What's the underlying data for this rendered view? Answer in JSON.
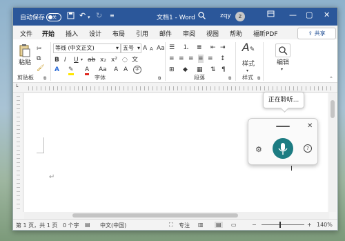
{
  "titlebar": {
    "autosave_label": "自动保存",
    "autosave_state": "关",
    "doc_title": "文档1 - Word",
    "user_name": "zqy",
    "avatar_initial": "z"
  },
  "tabs": [
    "文件",
    "开始",
    "插入",
    "设计",
    "布局",
    "引用",
    "邮件",
    "审阅",
    "视图",
    "帮助",
    "福昕PDF"
  ],
  "active_tab": "开始",
  "share_label": "共享",
  "ribbon": {
    "clipboard": {
      "paste_label": "粘贴",
      "group_label": "剪贴板"
    },
    "font": {
      "font_name": "等线 (中文正文)",
      "font_size": "五号",
      "size_up": "A",
      "size_down": "A",
      "clear_fmt": "Aa",
      "bold": "B",
      "italic": "I",
      "underline": "U",
      "strike": "ab",
      "subscript": "x₂",
      "superscript": "x²",
      "text_effect": "A",
      "highlight": "✎",
      "font_color": "A",
      "change_case": "Aa",
      "grow_a": "A",
      "phonetic": "A",
      "enclose": "字",
      "group_label": "字体"
    },
    "paragraph": {
      "group_label": "段落"
    },
    "styles": {
      "label": "样式",
      "group_label": "样式"
    },
    "editing": {
      "label": "编辑"
    }
  },
  "dictate": {
    "listening_text": "正在聆听...",
    "help_symbol": "?"
  },
  "document": {
    "paragraph_mark": "↵"
  },
  "statusbar": {
    "page": "第 1 页，共 1 页",
    "words": "0 个字",
    "language": "中文(中国)",
    "focus": "专注",
    "zoom_minus": "−",
    "zoom_plus": "+",
    "zoom": "140%"
  },
  "colors": {
    "accent": "#2b579a",
    "mic": "#1d7c82"
  }
}
